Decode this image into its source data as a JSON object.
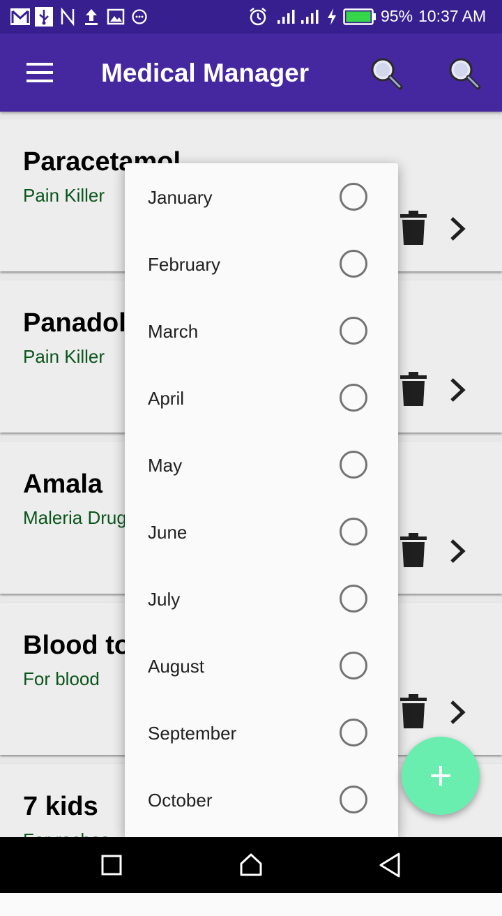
{
  "status_bar": {
    "battery_percent": "95%",
    "time": "10:37 AM",
    "icons_left": [
      "gmail-icon",
      "usb-icon",
      "nfc-icon",
      "upload-icon",
      "gallery-icon",
      "chat-icon"
    ],
    "icons_right": [
      "alarm-icon",
      "signal-icon",
      "signal-icon",
      "charging-icon",
      "battery-icon"
    ]
  },
  "app_bar": {
    "title": "Medical Manager",
    "icons": [
      "menu-icon",
      "search-icon",
      "search-icon"
    ]
  },
  "medicines": [
    {
      "name": "Paracetamol",
      "type": "Pain Killer"
    },
    {
      "name": "Panadol",
      "type": "Pain Killer"
    },
    {
      "name": "Amala",
      "type": "Maleria Drug"
    },
    {
      "name": "Blood tonic",
      "type": "For blood"
    },
    {
      "name": "7 kids",
      "type": "For raches"
    }
  ],
  "month_dialog": {
    "options": [
      "January",
      "February",
      "March",
      "April",
      "May",
      "June",
      "July",
      "August",
      "September",
      "October"
    ]
  },
  "colors": {
    "app_bar": "#4527a0",
    "status_bar": "#371f90",
    "fab": "#69eeb0",
    "subtitle": "#0b5a1e"
  }
}
